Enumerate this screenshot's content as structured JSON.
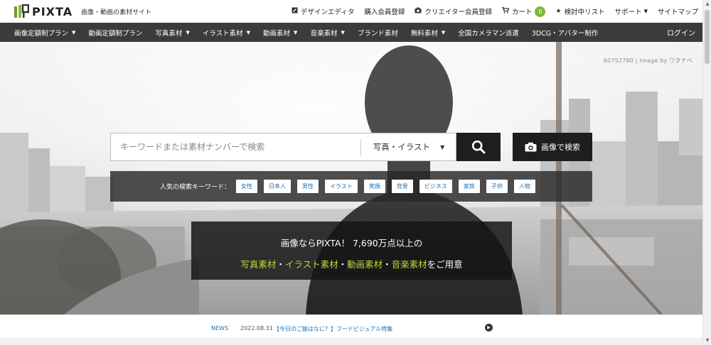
{
  "brand": {
    "name": "PIXTA",
    "tagline": "画像・動画の素材サイト"
  },
  "header_links": [
    {
      "label": "デザインエディタ",
      "icon": "edit-icon"
    },
    {
      "label": "購入会員登録",
      "icon": ""
    },
    {
      "label": "クリエイター会員登録",
      "icon": "camera-icon"
    },
    {
      "label": "カート",
      "icon": "cart-icon",
      "badge": "0"
    },
    {
      "label": "検討中リスト",
      "icon": "star-icon"
    },
    {
      "label": "サポート",
      "icon": "",
      "caret": true
    },
    {
      "label": "サイトマップ",
      "icon": ""
    }
  ],
  "nav": {
    "items": [
      {
        "label": "画像定額制プラン",
        "caret": true
      },
      {
        "label": "動画定額制プラン",
        "caret": false
      },
      {
        "label": "写真素材",
        "caret": true
      },
      {
        "label": "イラスト素材",
        "caret": true
      },
      {
        "label": "動画素材",
        "caret": true
      },
      {
        "label": "音楽素材",
        "caret": true
      },
      {
        "label": "ブランド素材",
        "caret": false
      },
      {
        "label": "無料素材",
        "caret": true
      },
      {
        "label": "全国カメラマン派遣",
        "caret": false
      },
      {
        "label": "3DCG・アバター制作",
        "caret": false
      }
    ],
    "login": "ログイン"
  },
  "hero": {
    "credit": "60752780 | Image by ワタナベ",
    "search": {
      "placeholder": "キーワードまたは素材ナンバーで検索",
      "category": "写真・イラスト",
      "image_search_label": "画像で検索"
    },
    "popular": {
      "label": "人気の検索キーワード：",
      "keywords": [
        "女性",
        "日本人",
        "男性",
        "イラスト",
        "笑顔",
        "背景",
        "ビジネス",
        "家族",
        "子供",
        "人物"
      ]
    },
    "promo": {
      "line1": "画像ならPIXTA！ 7,690万点以上の",
      "highlights": [
        "写真素材",
        "イラスト素材",
        "動画素材",
        "音楽素材"
      ],
      "separator": "・",
      "suffix": "をご用意"
    }
  },
  "news": {
    "label": "NEWS",
    "date": "2022.08.31",
    "text": "【今日のご飯はなに？】フードビジュアル特集"
  },
  "colors": {
    "nav_bg": "#3b3b3b",
    "accent_green": "#b8d936",
    "link_blue": "#1a6fb5",
    "badge_green": "#7cb83b"
  }
}
